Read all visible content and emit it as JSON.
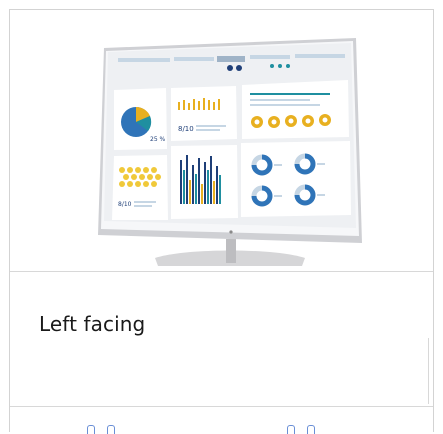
{
  "product_card": {
    "view_label": "Left facing",
    "image_icon": "monitor-icon",
    "screen_content": {
      "gauge_percent_labels": [
        "25 %",
        "8/10",
        "8/10"
      ],
      "accent_colors": {
        "teal": "#1f8fa0",
        "gold": "#e8b020",
        "blue": "#2f74b8",
        "navy": "#1f3f78",
        "yellow": "#f0c93a"
      }
    }
  }
}
